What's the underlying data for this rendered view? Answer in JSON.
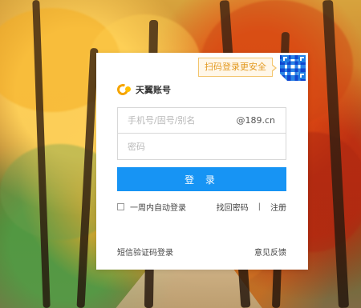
{
  "background": {
    "theme_colors": {
      "gold": "#f4ac20",
      "orange": "#d97d28",
      "red": "#b52c10",
      "green": "#6c9e4b",
      "path": "#cdb58b"
    }
  },
  "login": {
    "qr_tip": "扫码登录更安全",
    "brand_name": "天翼账号",
    "username_placeholder": "手机号/固号/别名",
    "username_suffix": "@189.cn",
    "password_placeholder": "密码",
    "login_button": "登 录",
    "remember_label": "一周内自动登录",
    "forgot_password": "找回密码",
    "separator": "|",
    "register": "注册",
    "sms_login": "短信验证码登录",
    "feedback": "意见反馈"
  },
  "icons": {
    "brand": "brand-logo-icon",
    "qr": "qr-code-icon",
    "checkbox": "checkbox-icon"
  }
}
